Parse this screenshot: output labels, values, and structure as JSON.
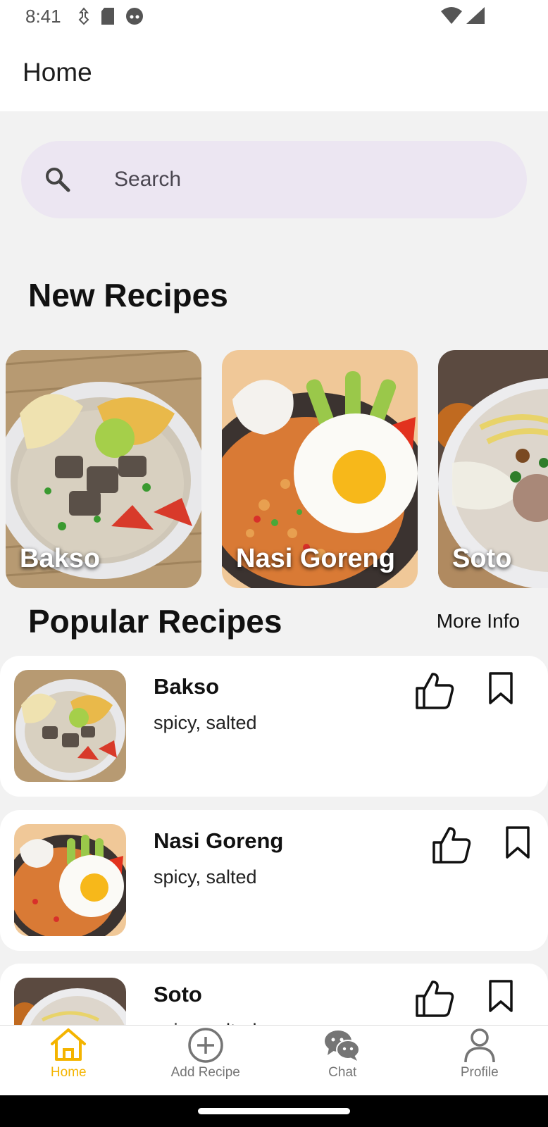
{
  "status_bar": {
    "time": "8:41"
  },
  "app_bar": {
    "title": "Home"
  },
  "search": {
    "placeholder": "Search"
  },
  "new_recipes": {
    "title": "New Recipes",
    "items": [
      {
        "name": "Bakso"
      },
      {
        "name": "Nasi Goreng"
      },
      {
        "name": "Soto"
      }
    ]
  },
  "popular_recipes": {
    "title": "Popular Recipes",
    "more_label": "More Info",
    "items": [
      {
        "name": "Bakso",
        "tags": "spicy, salted"
      },
      {
        "name": "Nasi Goreng",
        "tags": "spicy, salted"
      },
      {
        "name": "Soto",
        "tags": "spicy, salted"
      }
    ]
  },
  "bottom_nav": {
    "items": [
      {
        "label": "Home",
        "icon": "home-icon",
        "active": true
      },
      {
        "label": "Add Recipe",
        "icon": "add-circle-icon",
        "active": false
      },
      {
        "label": "Chat",
        "icon": "chat-icon",
        "active": false
      },
      {
        "label": "Profile",
        "icon": "profile-icon",
        "active": false
      }
    ]
  },
  "colors": {
    "accent": "#f4b400",
    "search_bg": "#ece6f2",
    "background": "#f2f2f2"
  }
}
